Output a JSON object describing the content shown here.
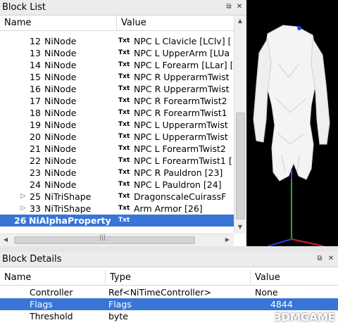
{
  "block_list": {
    "title": "Block List",
    "columns": {
      "name": "Name",
      "value": "Value"
    },
    "rows": [
      {
        "num": "12",
        "type": "NiNode",
        "tag": "Txt",
        "value": "NPC L Clavicle [LClv] [1",
        "expander": ""
      },
      {
        "num": "13",
        "type": "NiNode",
        "tag": "Txt",
        "value": "NPC L UpperArm [LUa",
        "expander": ""
      },
      {
        "num": "14",
        "type": "NiNode",
        "tag": "Txt",
        "value": "NPC L Forearm [LLar] [",
        "expander": ""
      },
      {
        "num": "15",
        "type": "NiNode",
        "tag": "Txt",
        "value": "NPC R UpperarmTwist",
        "expander": ""
      },
      {
        "num": "16",
        "type": "NiNode",
        "tag": "Txt",
        "value": "NPC R UpperarmTwist",
        "expander": ""
      },
      {
        "num": "17",
        "type": "NiNode",
        "tag": "Txt",
        "value": "NPC R ForearmTwist2",
        "expander": ""
      },
      {
        "num": "18",
        "type": "NiNode",
        "tag": "Txt",
        "value": "NPC R ForearmTwist1",
        "expander": ""
      },
      {
        "num": "19",
        "type": "NiNode",
        "tag": "Txt",
        "value": "NPC L UpperarmTwist",
        "expander": ""
      },
      {
        "num": "20",
        "type": "NiNode",
        "tag": "Txt",
        "value": "NPC L UpperarmTwist",
        "expander": ""
      },
      {
        "num": "21",
        "type": "NiNode",
        "tag": "Txt",
        "value": "NPC L ForearmTwist2",
        "expander": ""
      },
      {
        "num": "22",
        "type": "NiNode",
        "tag": "Txt",
        "value": "NPC L ForearmTwist1 [",
        "expander": ""
      },
      {
        "num": "23",
        "type": "NiNode",
        "tag": "Txt",
        "value": "NPC R Pauldron [23]",
        "expander": ""
      },
      {
        "num": "24",
        "type": "NiNode",
        "tag": "Txt",
        "value": "NPC L Pauldron [24]",
        "expander": ""
      },
      {
        "num": "25",
        "type": "NiTriShape",
        "tag": "Txt",
        "value": "DragonscaleCuirassF",
        "expander": "▷"
      },
      {
        "num": "33",
        "type": "NiTriShape",
        "tag": "Txt",
        "value": "Arm Armor [26]",
        "expander": "▷"
      },
      {
        "num": "26",
        "type": "NiAlphaProperty",
        "tag": "Txt",
        "value": "",
        "expander": ""
      }
    ],
    "selected_index": 15
  },
  "block_details": {
    "title": "Block Details",
    "columns": {
      "name": "Name",
      "type": "Type",
      "value": "Value"
    },
    "rows": [
      {
        "name": "Controller",
        "type": "Ref<NiTimeController>",
        "value": "None"
      },
      {
        "name": "Flags",
        "type": "Flags",
        "value": "4844"
      },
      {
        "name": "Threshold",
        "type": "byte",
        "value": ""
      }
    ],
    "selected_index": 1
  },
  "watermark": "3DMGAME",
  "colors": {
    "selection": "#3875d7",
    "viewport_bg": "#000000"
  }
}
